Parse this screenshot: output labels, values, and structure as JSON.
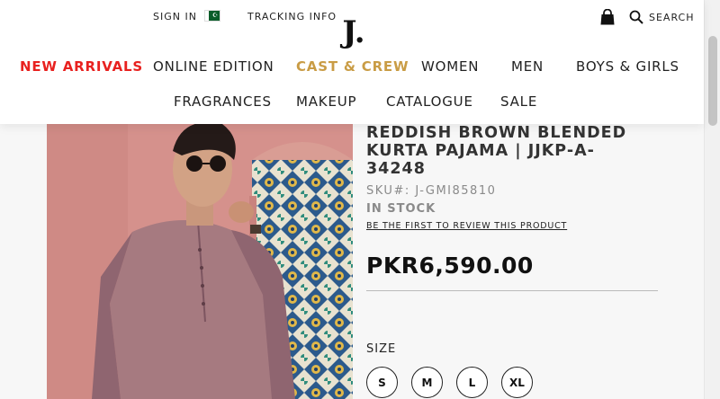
{
  "header": {
    "sign_in": "SIGN IN",
    "flag_glyph": "☪",
    "tracking_info": "TRACKING INFO",
    "logo": "J.",
    "search_label": "SEARCH",
    "icons": [
      "flag-icon",
      "bag-icon",
      "search-icon"
    ]
  },
  "nav": {
    "row1": [
      "NEW ARRIVALS",
      "ONLINE EDITION",
      "CAST & CREW",
      "WOMEN",
      "MEN",
      "BOYS & GIRLS"
    ],
    "row2": [
      "FRAGRANCES",
      "MAKEUP",
      "CATALOGUE",
      "SALE"
    ]
  },
  "colors": {
    "new_arrivals": "#e8211f",
    "cast_crew": "#c99c45",
    "text": "#222222",
    "muted": "#8a8a8a"
  },
  "product": {
    "title": "REDDISH BROWN BLENDED KURTA PAJAMA | JJKP-A-34248",
    "sku": "SKU#:  J-GMI85810",
    "stock": "IN STOCK",
    "review_link": "BE THE FIRST TO REVIEW THIS PRODUCT",
    "price": "PKR6,590.00",
    "size_label": "SIZE",
    "sizes": [
      "S",
      "M",
      "L",
      "XL"
    ]
  }
}
